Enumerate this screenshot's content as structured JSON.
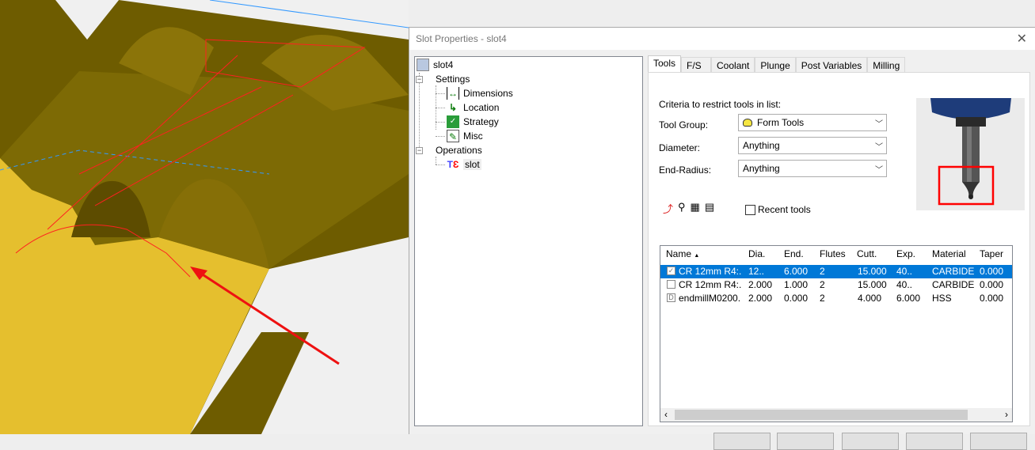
{
  "dialog": {
    "title": "Slot Properties - slot4",
    "close_label": "✕"
  },
  "tree": {
    "root": "slot4",
    "settings": "Settings",
    "settings_children": [
      "Dimensions",
      "Location",
      "Strategy",
      "Misc"
    ],
    "operations": "Operations",
    "operations_children": [
      "slot"
    ]
  },
  "tabs": [
    "Tools",
    "F/S",
    "Coolant",
    "Plunge",
    "Post Variables",
    "Milling"
  ],
  "tools": {
    "criteria_label": "Criteria to restrict tools in list:",
    "tool_group_label": "Tool Group:",
    "tool_group_value": "Form Tools",
    "diameter_label": "Diameter:",
    "diameter_value": "Anything",
    "end_radius_label": "End-Radius:",
    "end_radius_value": "Anything",
    "recent_tools_label": "Recent tools",
    "recent_tools_checked": false,
    "columns": [
      "Name",
      "Dia.",
      "End.",
      "Flutes",
      "Cutt.",
      "Exp.",
      "Material",
      "Taper"
    ],
    "sort_indicator": "▲",
    "rows": [
      {
        "name": "CR 12mm R4:.",
        "dia": "12..",
        "end": "6.000",
        "flutes": "2",
        "cutt": "15.000",
        "exp": "40..",
        "material": "CARBIDE",
        "taper": "0.000",
        "selected": true
      },
      {
        "name": "CR 12mm R4:.",
        "dia": "2.000",
        "end": "1.000",
        "flutes": "2",
        "cutt": "15.000",
        "exp": "40..",
        "material": "CARBIDE",
        "taper": "0.000",
        "selected": false
      },
      {
        "name": "endmillM0200.",
        "dia": "2.000",
        "end": "0.000",
        "flutes": "2",
        "cutt": "4.000",
        "exp": "6.000",
        "material": "HSS",
        "taper": "0.000",
        "selected": false
      }
    ]
  },
  "colors": {
    "selection": "#0078d7",
    "highlight": "#ff0000",
    "part": "#7a6400"
  }
}
